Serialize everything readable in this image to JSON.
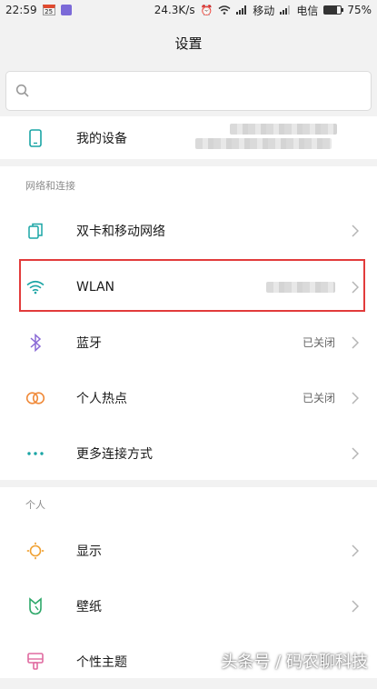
{
  "status_bar": {
    "time": "22:59",
    "calendar_day": "25",
    "network_speed": "24.3K/s",
    "carrier_1": "移动",
    "carrier_2": "电信",
    "battery_level": 0.75,
    "battery_text": "75%"
  },
  "header": {
    "title": "设置"
  },
  "search": {
    "placeholder": ""
  },
  "sections": {
    "device": {
      "items": [
        {
          "label": "我的设备",
          "icon": "phone-icon"
        }
      ]
    },
    "network": {
      "title": "网络和连接",
      "items": [
        {
          "label": "双卡和移动网络",
          "icon": "sim-cards-icon",
          "value": ""
        },
        {
          "label": "WLAN",
          "icon": "wifi-icon",
          "value": ""
        },
        {
          "label": "蓝牙",
          "icon": "bluetooth-icon",
          "value": "已关闭"
        },
        {
          "label": "个人热点",
          "icon": "hotspot-icon",
          "value": "已关闭"
        },
        {
          "label": "更多连接方式",
          "icon": "more-dots-icon",
          "value": ""
        }
      ]
    },
    "personal": {
      "title": "个人",
      "items": [
        {
          "label": "显示",
          "icon": "sun-icon"
        },
        {
          "label": "壁纸",
          "icon": "wallpaper-icon"
        },
        {
          "label": "个性主题",
          "icon": "theme-icon"
        }
      ]
    }
  },
  "colors": {
    "accent_teal": "#1aa5a5",
    "highlight_red": "#e23b3b",
    "bluetooth_purple": "#8a6ad6",
    "hotspot_orange": "#f08a3a",
    "display_orange": "#f0a030",
    "wallpaper_green": "#2ea86a",
    "theme_pink": "#e06aa0"
  },
  "watermark": "头条号 / 码农聊科技"
}
